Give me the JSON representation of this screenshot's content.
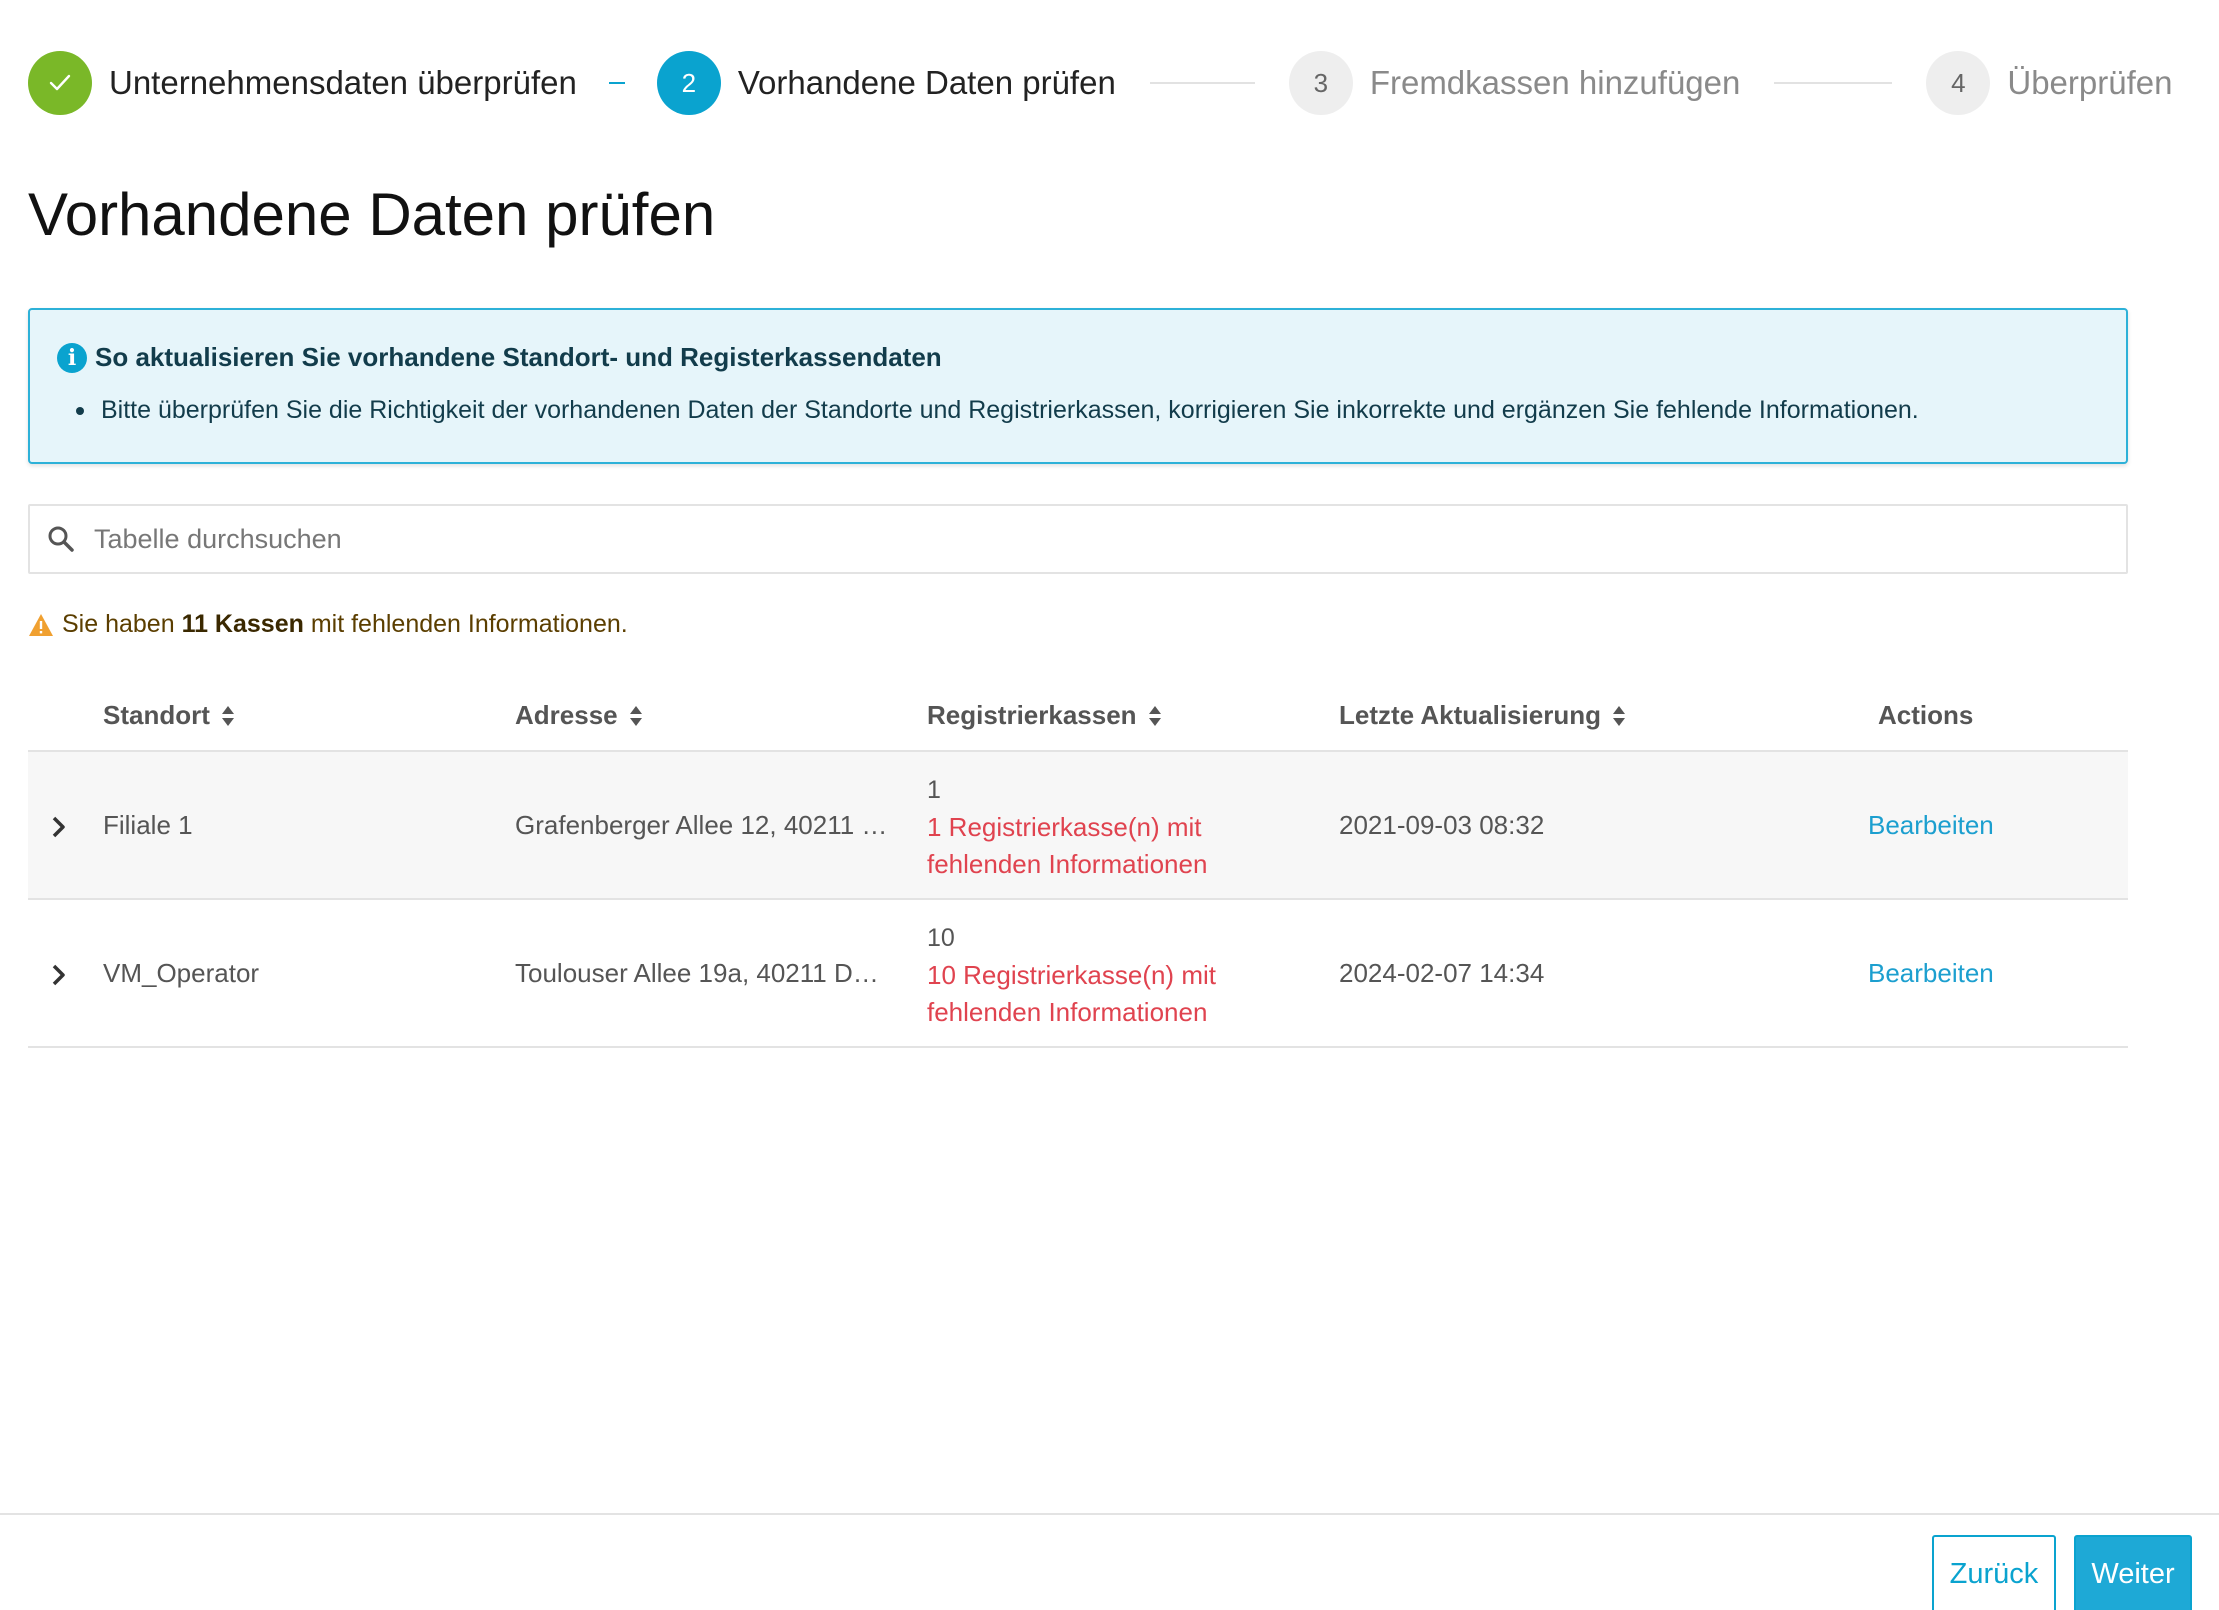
{
  "stepper": {
    "steps": [
      {
        "number": "✓",
        "label": "Unternehmensdaten überprüfen",
        "state": "done"
      },
      {
        "number": "2",
        "label": "Vorhandene Daten prüfen",
        "state": "active"
      },
      {
        "number": "3",
        "label": "Fremdkassen hinzufügen",
        "state": "todo"
      },
      {
        "number": "4",
        "label": "Überprüfen",
        "state": "todo"
      }
    ]
  },
  "page": {
    "title": "Vorhandene Daten prüfen"
  },
  "info": {
    "heading": "So aktualisieren Sie vorhandene Standort- und Registerkassendaten",
    "bullet": "Bitte überprüfen Sie die Richtigkeit der vorhandenen Daten der Standorte und Registrierkassen, korrigieren Sie inkorrekte und ergänzen Sie fehlende Informationen."
  },
  "search": {
    "placeholder": "Tabelle durchsuchen",
    "value": ""
  },
  "warning": {
    "prefix": "Sie haben",
    "count": "11 Kassen",
    "suffix": "mit fehlenden Informationen."
  },
  "table": {
    "headers": {
      "standort": "Standort",
      "adresse": "Adresse",
      "registrierkassen": "Registrierkassen",
      "letzte": "Letzte Aktualisierung",
      "actions": "Actions"
    },
    "rows": [
      {
        "standort": "Filiale 1",
        "adresse": "Grafenberger Allee 12, 40211 …",
        "reg_count": "1",
        "reg_missing_1": "1 Registrierkasse(n) mit",
        "reg_missing_2": "fehlenden Informationen",
        "letzte": "2021-09-03 08:32",
        "action": "Bearbeiten"
      },
      {
        "standort": "VM_Operator",
        "adresse": "Toulouser Allee 19a, 40211 D…",
        "reg_count": "10",
        "reg_missing_1": "10 Registrierkasse(n) mit",
        "reg_missing_2": "fehlenden Informationen",
        "letzte": "2024-02-07 14:34",
        "action": "Bearbeiten"
      }
    ]
  },
  "footer": {
    "back_label": "Zurück",
    "next_label": "Weiter"
  },
  "colors": {
    "accent": "#0aa3cf",
    "done": "#7ab828",
    "error": "#e0434f",
    "warning": "#f0a030",
    "info_bg": "#e6f5fa"
  }
}
